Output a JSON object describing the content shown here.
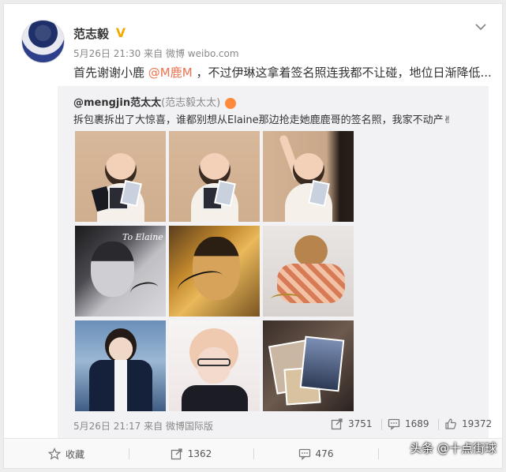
{
  "post": {
    "author": "范志毅",
    "verified": "V",
    "time": "5月26日 21:30",
    "source_prefix": "来自",
    "source": "微博 weibo.com",
    "text_before": "首先谢谢小鹿 ",
    "mention": "@M鹿M",
    "text_after": " ，不过伊琳这拿着签名照连我都不让碰，地位日渐降低..."
  },
  "repost": {
    "user": "@mengjin范太太",
    "remark": "(范志毅太太)",
    "text": "拆包裹拆出了大惊喜，谁都别想从Elaine那边抢走她鹿鹿哥的签名照，我家不动产",
    "emoji": "✌",
    "photo_sig_text": "To Elaine",
    "time": "5月26日 21:17",
    "source_prefix": "来自",
    "source": "微博国际版",
    "repost_count": "3751",
    "comment_count": "1689",
    "like_count": "19372"
  },
  "actions": {
    "favorite": "收藏",
    "repost": "1362",
    "comment": "476"
  },
  "watermark": "头条 @十点街球",
  "colors": {
    "accent": "#eb7350",
    "verified": "#f2a900",
    "repost_bg": "#f2f2f5"
  }
}
